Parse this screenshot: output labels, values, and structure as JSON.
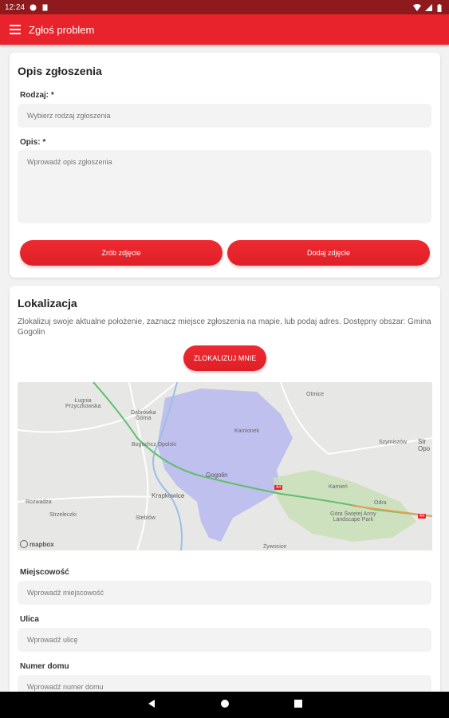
{
  "status_bar": {
    "time": "12:24"
  },
  "app_bar": {
    "title": "Zgłoś problem"
  },
  "report_card": {
    "title": "Opis zgłoszenia",
    "type_label": "Rodzaj: *",
    "type_placeholder": "Wybierz rodzaj zgłoszenia",
    "desc_label": "Opis: *",
    "desc_placeholder": "Wprowadź opis zgłoszenia",
    "take_photo": "Zrób zdjęcie",
    "add_photo": "Dodaj zdjęcie"
  },
  "location_card": {
    "title": "Lokalizacja",
    "description": "Zlokalizuj swoje aktualne położenie, zaznacz miejsce zgłoszenia na mapie, lub podaj adres. Dostępny obszar: Gmina Gogolin",
    "locate_button": "ZLOKALIZUJ MNIE",
    "map": {
      "attribution": "mapbox",
      "labels": {
        "lugnia": "Ługnia\nPrzyczkowska",
        "dabrowka": "Dąbrówka\nGórna",
        "otmice": "Otmice",
        "kamionek": "Kamionek",
        "boguslaw": "Boguchcz Opolski",
        "szymiszow": "Szymiszów",
        "str": "Str\nOpo",
        "gogolin": "Gogolin",
        "krapkowice": "Krapkowice",
        "kamien": "Kamień",
        "odra": "Odra",
        "rozwadza": "Rozwadza",
        "strzeleczki": "Strzeleczki",
        "steblow": "Steblów",
        "park": "Góra Świętej Anny\nLandscape Park",
        "zywocice": "Żywocice",
        "road_a4": "A4"
      }
    },
    "city_label": "Miejscowość",
    "city_placeholder": "Wprowadź miejscowość",
    "street_label": "Ulica",
    "street_placeholder": "Wprowadź ulicę",
    "house_label": "Numer domu",
    "house_placeholder": "Wprowadź numer domu"
  },
  "colors": {
    "accent": "#e8232b",
    "status_bar": "#8e1a1e"
  }
}
